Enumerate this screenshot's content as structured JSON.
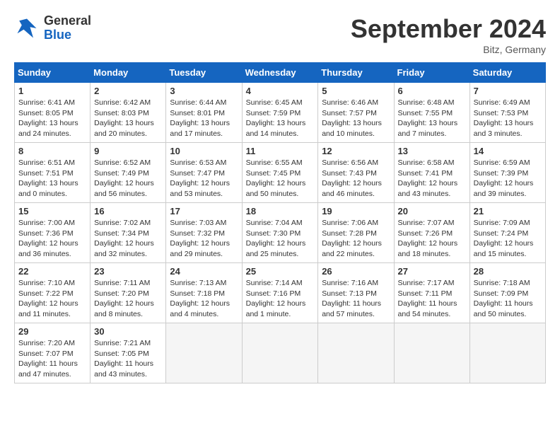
{
  "header": {
    "logo_general": "General",
    "logo_blue": "Blue",
    "month_title": "September 2024",
    "location": "Bitz, Germany"
  },
  "weekdays": [
    "Sunday",
    "Monday",
    "Tuesday",
    "Wednesday",
    "Thursday",
    "Friday",
    "Saturday"
  ],
  "weeks": [
    [
      {
        "day": "1",
        "sunrise": "6:41 AM",
        "sunset": "8:05 PM",
        "daylight": "13 hours and 24 minutes."
      },
      {
        "day": "2",
        "sunrise": "6:42 AM",
        "sunset": "8:03 PM",
        "daylight": "13 hours and 20 minutes."
      },
      {
        "day": "3",
        "sunrise": "6:44 AM",
        "sunset": "8:01 PM",
        "daylight": "13 hours and 17 minutes."
      },
      {
        "day": "4",
        "sunrise": "6:45 AM",
        "sunset": "7:59 PM",
        "daylight": "13 hours and 14 minutes."
      },
      {
        "day": "5",
        "sunrise": "6:46 AM",
        "sunset": "7:57 PM",
        "daylight": "13 hours and 10 minutes."
      },
      {
        "day": "6",
        "sunrise": "6:48 AM",
        "sunset": "7:55 PM",
        "daylight": "13 hours and 7 minutes."
      },
      {
        "day": "7",
        "sunrise": "6:49 AM",
        "sunset": "7:53 PM",
        "daylight": "13 hours and 3 minutes."
      }
    ],
    [
      {
        "day": "8",
        "sunrise": "6:51 AM",
        "sunset": "7:51 PM",
        "daylight": "13 hours and 0 minutes."
      },
      {
        "day": "9",
        "sunrise": "6:52 AM",
        "sunset": "7:49 PM",
        "daylight": "12 hours and 56 minutes."
      },
      {
        "day": "10",
        "sunrise": "6:53 AM",
        "sunset": "7:47 PM",
        "daylight": "12 hours and 53 minutes."
      },
      {
        "day": "11",
        "sunrise": "6:55 AM",
        "sunset": "7:45 PM",
        "daylight": "12 hours and 50 minutes."
      },
      {
        "day": "12",
        "sunrise": "6:56 AM",
        "sunset": "7:43 PM",
        "daylight": "12 hours and 46 minutes."
      },
      {
        "day": "13",
        "sunrise": "6:58 AM",
        "sunset": "7:41 PM",
        "daylight": "12 hours and 43 minutes."
      },
      {
        "day": "14",
        "sunrise": "6:59 AM",
        "sunset": "7:39 PM",
        "daylight": "12 hours and 39 minutes."
      }
    ],
    [
      {
        "day": "15",
        "sunrise": "7:00 AM",
        "sunset": "7:36 PM",
        "daylight": "12 hours and 36 minutes."
      },
      {
        "day": "16",
        "sunrise": "7:02 AM",
        "sunset": "7:34 PM",
        "daylight": "12 hours and 32 minutes."
      },
      {
        "day": "17",
        "sunrise": "7:03 AM",
        "sunset": "7:32 PM",
        "daylight": "12 hours and 29 minutes."
      },
      {
        "day": "18",
        "sunrise": "7:04 AM",
        "sunset": "7:30 PM",
        "daylight": "12 hours and 25 minutes."
      },
      {
        "day": "19",
        "sunrise": "7:06 AM",
        "sunset": "7:28 PM",
        "daylight": "12 hours and 22 minutes."
      },
      {
        "day": "20",
        "sunrise": "7:07 AM",
        "sunset": "7:26 PM",
        "daylight": "12 hours and 18 minutes."
      },
      {
        "day": "21",
        "sunrise": "7:09 AM",
        "sunset": "7:24 PM",
        "daylight": "12 hours and 15 minutes."
      }
    ],
    [
      {
        "day": "22",
        "sunrise": "7:10 AM",
        "sunset": "7:22 PM",
        "daylight": "12 hours and 11 minutes."
      },
      {
        "day": "23",
        "sunrise": "7:11 AM",
        "sunset": "7:20 PM",
        "daylight": "12 hours and 8 minutes."
      },
      {
        "day": "24",
        "sunrise": "7:13 AM",
        "sunset": "7:18 PM",
        "daylight": "12 hours and 4 minutes."
      },
      {
        "day": "25",
        "sunrise": "7:14 AM",
        "sunset": "7:16 PM",
        "daylight": "12 hours and 1 minute."
      },
      {
        "day": "26",
        "sunrise": "7:16 AM",
        "sunset": "7:13 PM",
        "daylight": "11 hours and 57 minutes."
      },
      {
        "day": "27",
        "sunrise": "7:17 AM",
        "sunset": "7:11 PM",
        "daylight": "11 hours and 54 minutes."
      },
      {
        "day": "28",
        "sunrise": "7:18 AM",
        "sunset": "7:09 PM",
        "daylight": "11 hours and 50 minutes."
      }
    ],
    [
      {
        "day": "29",
        "sunrise": "7:20 AM",
        "sunset": "7:07 PM",
        "daylight": "11 hours and 47 minutes."
      },
      {
        "day": "30",
        "sunrise": "7:21 AM",
        "sunset": "7:05 PM",
        "daylight": "11 hours and 43 minutes."
      },
      null,
      null,
      null,
      null,
      null
    ]
  ]
}
